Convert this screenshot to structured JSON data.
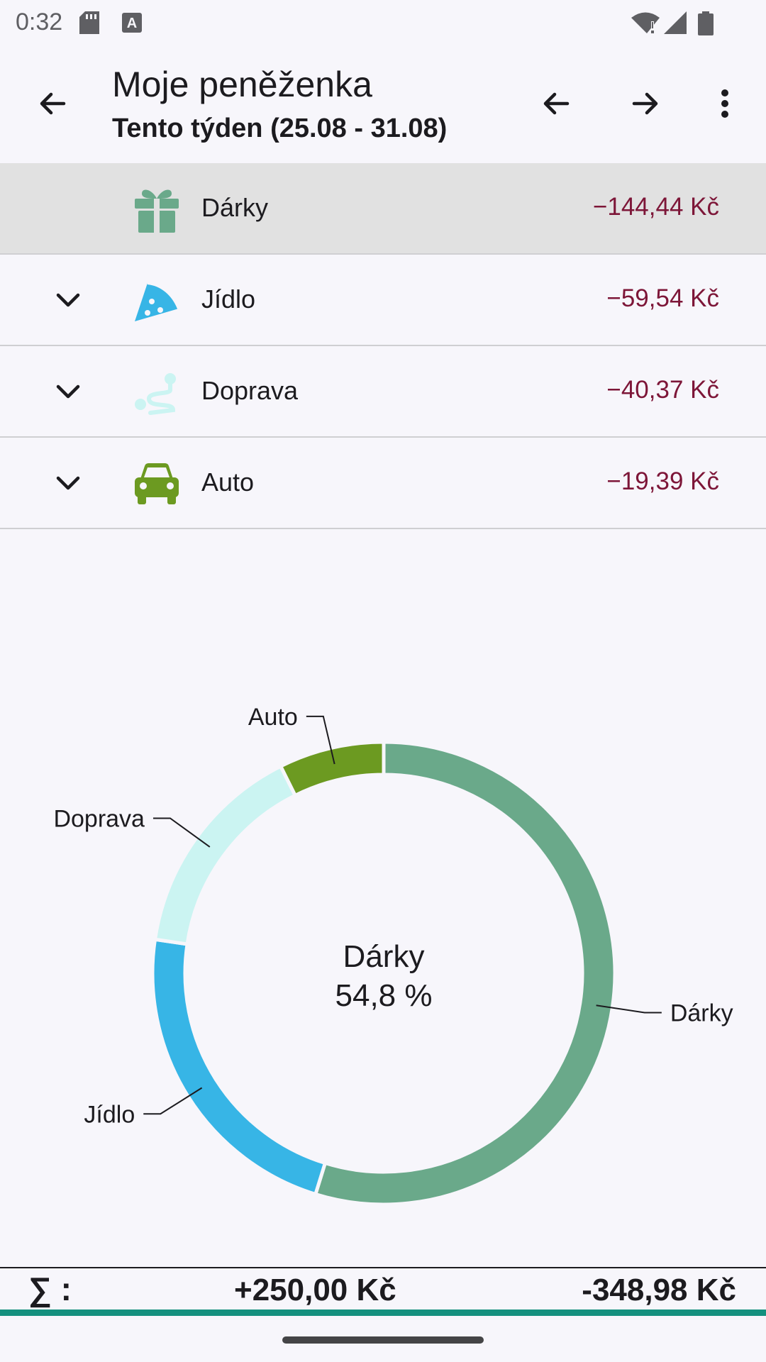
{
  "status_bar": {
    "time": "0:32",
    "icons": [
      "sd-card-icon",
      "keyboard-a-icon",
      "wifi-alert-icon",
      "signal-icon",
      "battery-icon"
    ]
  },
  "toolbar": {
    "title": "Moje peněženka",
    "subtitle": "Tento týden (25.08 - 31.08)",
    "icons": [
      "back-arrow-icon",
      "previous-period-icon",
      "next-period-icon",
      "more-options-icon"
    ]
  },
  "categories": [
    {
      "name": "Dárky",
      "amount": "−144,44 Kč",
      "icon": "gift-icon",
      "color": "#6aa98a",
      "expandable": false,
      "selected": true
    },
    {
      "name": "Jídlo",
      "amount": "−59,54 Kč",
      "icon": "pizza-icon",
      "color": "#37b5e6",
      "expandable": true,
      "selected": false
    },
    {
      "name": "Doprava",
      "amount": "−40,37 Kč",
      "icon": "route-icon",
      "color": "#cbf4f2",
      "expandable": true,
      "selected": false
    },
    {
      "name": "Auto",
      "amount": "−19,39 Kč",
      "icon": "car-icon",
      "color": "#6c9a21",
      "expandable": true,
      "selected": false
    }
  ],
  "chart_data": {
    "type": "pie",
    "donut": true,
    "categories": [
      "Dárky",
      "Jídlo",
      "Doprava",
      "Auto"
    ],
    "values": [
      144.44,
      59.54,
      40.37,
      19.39
    ],
    "colors": [
      "#6aa98a",
      "#37b5e6",
      "#cbf4f2",
      "#6c9a21"
    ],
    "center_label": "Dárky",
    "center_value": "54,8 %"
  },
  "footer": {
    "sigma": "∑ :",
    "income": "+250,00 Kč",
    "expense": "-348,98 Kč"
  },
  "colors": {
    "expense_text": "#7d1638",
    "accent": "#14907e",
    "background": "#f7f6fb",
    "selected_row": "#e1e1e1"
  }
}
